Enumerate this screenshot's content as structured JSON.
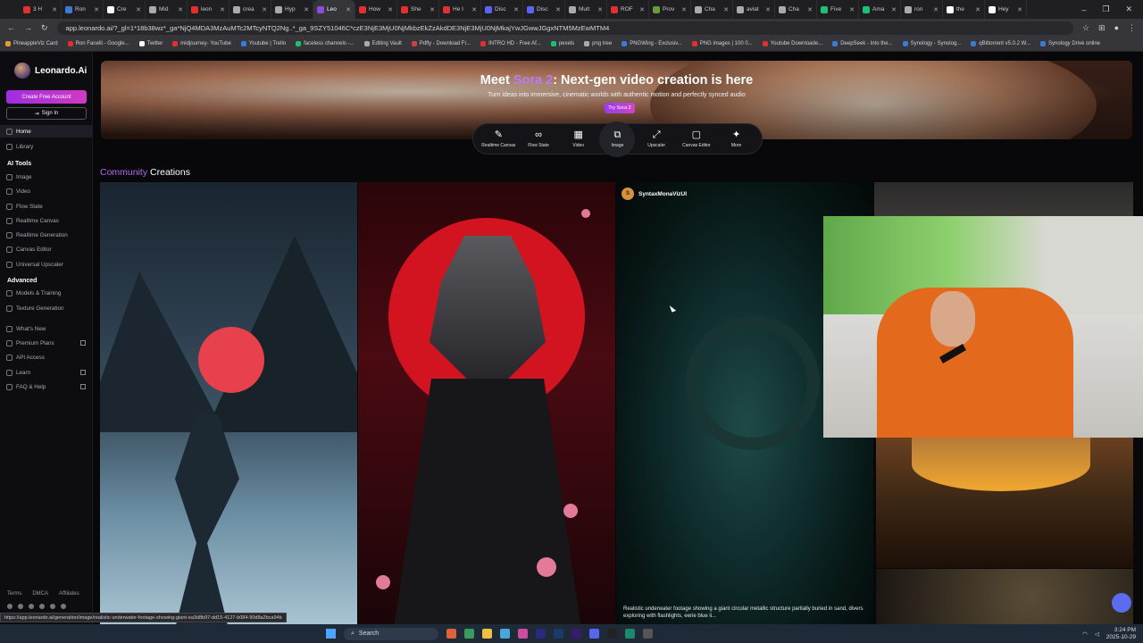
{
  "browser": {
    "tabs": [
      {
        "label": "3 H",
        "color": "#e03030"
      },
      {
        "label": "Ron",
        "color": "#3a7bd5"
      },
      {
        "label": "Cre",
        "color": "#ffffff"
      },
      {
        "label": "Mid",
        "color": "#aaaaaa"
      },
      {
        "label": "leon",
        "color": "#e03030"
      },
      {
        "label": "crea",
        "color": "#aaaaaa"
      },
      {
        "label": "Hyp",
        "color": "#aaaaaa"
      },
      {
        "label": "Leo",
        "color": "#8a4fd8"
      },
      {
        "label": "How",
        "color": "#e03030"
      },
      {
        "label": "She",
        "color": "#e03030"
      },
      {
        "label": "He I",
        "color": "#e03030"
      },
      {
        "label": "Disc",
        "color": "#5865f2"
      },
      {
        "label": "Disc",
        "color": "#5865f2"
      },
      {
        "label": "Mult",
        "color": "#aaaaaa"
      },
      {
        "label": "ROF",
        "color": "#e03030"
      },
      {
        "label": "Prov",
        "color": "#6a9a3a"
      },
      {
        "label": "Cha",
        "color": "#aaaaaa"
      },
      {
        "label": "aviat",
        "color": "#aaaaaa"
      },
      {
        "label": "Cha",
        "color": "#aaaaaa"
      },
      {
        "label": "Five",
        "color": "#1dbf73"
      },
      {
        "label": "Ama",
        "color": "#1dbf73"
      },
      {
        "label": "ron",
        "color": "#aaaaaa"
      },
      {
        "label": "the",
        "color": "#ffffff"
      },
      {
        "label": "Hey",
        "color": "#ffffff"
      }
    ],
    "url": "app.leonardo.ai/?_gl=1*18b38wz*_ga*NjQ4MDA3MzAuMTc2MTcyNTQ2Ng..*_ga_9SZY51046C*czE3NjE3MjU0NjMkbzEkZzAkdDE3NjE3MjU0NjMkajYwJGwwJGgxNTM5MzEwMTM4",
    "bookmarks": [
      {
        "label": "PineappleViz Card",
        "color": "#e0a030"
      },
      {
        "label": "Ron Fanelli - Google...",
        "color": "#e03030"
      },
      {
        "label": "Twitter",
        "color": "#ffffff"
      },
      {
        "label": "midjourney- YouTube",
        "color": "#e03030"
      },
      {
        "label": "Youtube | Trello",
        "color": "#3a7bd5"
      },
      {
        "label": "faceless channels -...",
        "color": "#1dbf73"
      },
      {
        "label": "Editing Vault",
        "color": "#aaaaaa"
      },
      {
        "label": "Pdfly - Download Fr...",
        "color": "#d04040"
      },
      {
        "label": "INTRO HD - Free Af...",
        "color": "#e03030"
      },
      {
        "label": "pexels",
        "color": "#1dbf73"
      },
      {
        "label": "png tree",
        "color": "#aaaaaa"
      },
      {
        "label": "PNGWing - Exclusiv...",
        "color": "#3a7bd5"
      },
      {
        "label": "PNG images | 100 0...",
        "color": "#e03030"
      },
      {
        "label": "Youtube Downloade...",
        "color": "#e03030"
      },
      {
        "label": "DeepSeek - Into the...",
        "color": "#3a7bd5"
      },
      {
        "label": "Synology - Synolog...",
        "color": "#3a7bd5"
      },
      {
        "label": "qBittorrent v5.0.2 W...",
        "color": "#3a7bd5"
      },
      {
        "label": "Synology Drive online",
        "color": "#3a7bd5"
      }
    ]
  },
  "sidebar": {
    "brand": "Leonardo.Ai",
    "create_label": "Create Free Account",
    "signin_label": "Sign In",
    "top_items": [
      {
        "label": "Home"
      },
      {
        "label": "Library"
      }
    ],
    "ai_tools_heading": "AI Tools",
    "ai_tools": [
      {
        "label": "Image"
      },
      {
        "label": "Video"
      },
      {
        "label": "Flow State"
      },
      {
        "label": "Realtime Canvas"
      },
      {
        "label": "Realtime Generation"
      },
      {
        "label": "Canvas Editor"
      },
      {
        "label": "Universal Upscaler"
      }
    ],
    "advanced_heading": "Advanced",
    "advanced": [
      {
        "label": "Models & Training"
      },
      {
        "label": "Texture Generation"
      }
    ],
    "more": [
      {
        "label": "What's New"
      },
      {
        "label": "Premium Plans"
      },
      {
        "label": "API Access"
      },
      {
        "label": "Learn"
      },
      {
        "label": "FAQ & Help"
      }
    ],
    "footer": [
      "Terms",
      "DMCA",
      "Affiliates"
    ]
  },
  "status_url": "https://app.leonardo.ai/generation/image/realistic-underwater-footage-showing-giant-ea3d8b97-dd15-4127-b084-90d8a2bca94b",
  "hero": {
    "title_pre": "Meet ",
    "title_accent": "Sora 2",
    "title_post": ": Next-gen video creation is here",
    "subtitle": "Turn ideas into immersive, cinematic worlds with authentic motion and perfectly synced audio",
    "button": "Try Sora 2"
  },
  "toolbar": [
    {
      "label": "Realtime Canvas",
      "glyph": "✎"
    },
    {
      "label": "Flow State",
      "glyph": "∞"
    },
    {
      "label": "Video",
      "glyph": "▦"
    },
    {
      "label": "Image",
      "glyph": "⧉"
    },
    {
      "label": "Upscaler",
      "glyph": "⤢"
    },
    {
      "label": "Canvas Editor",
      "glyph": "▢"
    },
    {
      "label": "More",
      "glyph": "✦"
    }
  ],
  "community": {
    "accent": "Community",
    "rest": "Creations"
  },
  "featured": {
    "author_initial": "S",
    "author": "SyntaxMonaVizUI",
    "caption": "Realistic underwater footage showing a giant circular metallic structure partially buried in sand, divers exploring with flashlights, eerie blue li..."
  },
  "taskbar": {
    "search": "Search",
    "time": "3:24 PM",
    "date": "2025-10-29"
  },
  "colors": {
    "accent": "#b463f0",
    "create_button": "#c23ad4"
  }
}
